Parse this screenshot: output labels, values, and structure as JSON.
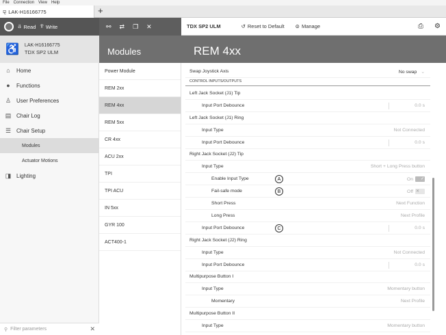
{
  "menu": [
    "File",
    "Connection",
    "View",
    "Help"
  ],
  "doc_tab": {
    "title": "LAK-H16166775",
    "new_tab": "+"
  },
  "toolbar": {
    "read_label": "Read",
    "write_label": "Write",
    "module_title": "TDX SP2 ULM",
    "reset_label": "Reset to Default",
    "manage_label": "Manage"
  },
  "device": {
    "id": "LAK-H16166775",
    "model": "TDX SP2 ULM"
  },
  "modules_header": "Modules",
  "page_title": "REM 4xx",
  "sidebar": {
    "items": [
      {
        "label": "Home",
        "icon": "home-icon"
      },
      {
        "label": "Functions",
        "icon": "functions-icon"
      },
      {
        "label": "User Preferences",
        "icon": "user-icon"
      },
      {
        "label": "Chair Log",
        "icon": "log-icon"
      },
      {
        "label": "Chair Setup",
        "icon": "setup-icon"
      },
      {
        "label": "Modules",
        "sub": true,
        "active": true
      },
      {
        "label": "Actuator Motions",
        "sub": true
      },
      {
        "label": "Lighting",
        "icon": "lighting-icon"
      }
    ],
    "search_placeholder": "Filter parameters"
  },
  "modules": [
    "Power Module",
    "REM 2xx",
    "REM 4xx",
    "REM 5xx",
    "CR 4xx",
    "ACU 2xx",
    "TPI",
    "TPI ACU",
    "IN 5xx",
    "GYR 100",
    "ACT400-1"
  ],
  "active_module": "REM 4xx",
  "params": [
    {
      "label": "Swap Joystick Axis",
      "value": "No swap",
      "type": "plain",
      "dark": true
    },
    {
      "label": "CONTROL INPUTS/OUTPUTS",
      "type": "heading"
    },
    {
      "label": "Left Jack Socket (J1) Tip",
      "type": "plain"
    },
    {
      "label": "Input Port Debounce",
      "value": "0.0 s",
      "type": "l1",
      "stepper": true
    },
    {
      "label": "Left Jack Socket (J1) Ring",
      "type": "plain"
    },
    {
      "label": "Input Type",
      "value": "Not Connected",
      "type": "l1"
    },
    {
      "label": "Input Port Debounce",
      "value": "0.0 s",
      "type": "l1",
      "stepper": true
    },
    {
      "label": "Right Jack Socket (J2) Tip",
      "type": "plain"
    },
    {
      "label": "Input Type",
      "value": "Short + Long Press button",
      "type": "l1"
    },
    {
      "label": "Enable Input Type",
      "value": "On",
      "type": "l2",
      "toggle": "on",
      "callout": "A"
    },
    {
      "label": "Fail-safe mode",
      "value": "Off",
      "type": "l2",
      "toggle": "off",
      "callout": "B"
    },
    {
      "label": "Short Press",
      "value": "Next Function",
      "type": "l2"
    },
    {
      "label": "Long Press",
      "value": "Next Profile",
      "type": "l2"
    },
    {
      "label": "Input Port Debounce",
      "value": "0.0 s",
      "type": "l1",
      "stepper": true,
      "callout": "C"
    },
    {
      "label": "Right Jack Socket (J2) Ring",
      "type": "plain"
    },
    {
      "label": "Input Type",
      "value": "Not Connected",
      "type": "l1"
    },
    {
      "label": "Input Port Debounce",
      "value": "0.0 s",
      "type": "l1",
      "stepper": true
    },
    {
      "label": "Multipurpose Button I",
      "type": "plain"
    },
    {
      "label": "Input Type",
      "value": "Momentary button",
      "type": "l1"
    },
    {
      "label": "Momentary",
      "value": "Next Profile",
      "type": "l2"
    },
    {
      "label": "Multipurpose Button II",
      "type": "plain"
    },
    {
      "label": "Input Type",
      "value": "Momentary button",
      "type": "l1"
    }
  ],
  "toggle_glyphs": {
    "on": "✓",
    "off": "✕"
  }
}
